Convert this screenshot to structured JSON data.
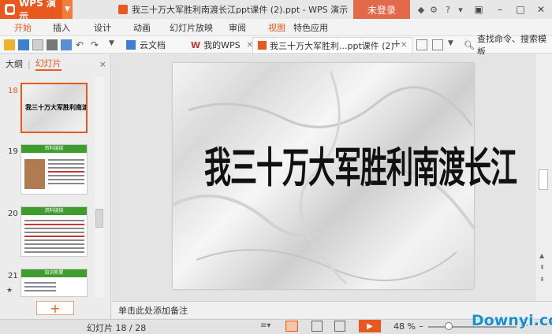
{
  "app": {
    "name": "WPS 演示",
    "doc_title": "我三十万大军胜利南渡长江ppt课件 (2).ppt - WPS 演示",
    "login": "未登录"
  },
  "menu": [
    "开始",
    "插入",
    "设计",
    "动画",
    "幻灯片放映",
    "审阅",
    "视图",
    "特色应用"
  ],
  "doc_tabs": [
    {
      "label": "云文档"
    },
    {
      "label": "我的WPS"
    },
    {
      "label": "我三十万大军胜利...ppt课件 (2)"
    }
  ],
  "search": {
    "label": "查找命令、搜索模板"
  },
  "left_panel": {
    "tab_outline": "大纲",
    "tab_slides": "幻灯片",
    "close": "×"
  },
  "thumbnails": [
    {
      "num": "18",
      "title": "我三十万大军胜利南渡长江"
    },
    {
      "num": "19",
      "title": "资料链接"
    },
    {
      "num": "20",
      "title": "资料链接"
    },
    {
      "num": "21",
      "title": "知识积累"
    }
  ],
  "slide": {
    "title": "我三十万大军胜利南渡长江"
  },
  "notes_placeholder": "单击此处添加备注",
  "status": {
    "slide_counter": "幻灯片 18 / 28",
    "zoom": "48 %"
  },
  "watermark": "Downyi.com",
  "colors": {
    "accent": "#e8581f",
    "login": "#e26a4a",
    "slide_green": "#3f9d2e"
  }
}
